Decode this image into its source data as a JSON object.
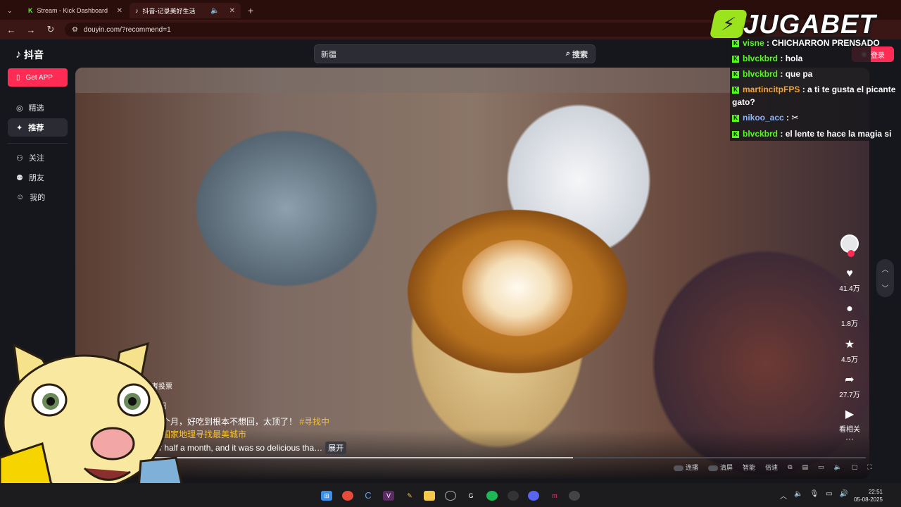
{
  "browser": {
    "tabs": [
      {
        "title": "Stream - Kick Dashboard",
        "active": false
      },
      {
        "title": "抖音-记录美好生活",
        "active": true
      }
    ],
    "new_tab": "+",
    "url": "douyin.com/?recommend=1"
  },
  "app": {
    "logo": "抖音",
    "get_app": "Get APP",
    "nav": [
      {
        "label": "精选",
        "icon": "compass-icon"
      },
      {
        "label": "推荐",
        "icon": "sparkle-icon",
        "active": true
      },
      {
        "label": "关注",
        "icon": "user-plus-icon"
      },
      {
        "label": "朋友",
        "icon": "users-icon"
      },
      {
        "label": "我的",
        "icon": "person-icon"
      }
    ],
    "search": {
      "value": "新疆",
      "button": "搜索"
    },
    "login": "登录"
  },
  "video": {
    "author": "作者投票",
    "date": "17日",
    "desc_line1": "了半个月，好吃到根本不想回，太顶了！",
    "desc_tag1": "#寻找中",
    "desc_line2": "中国国家地理寻找最美城市",
    "desc_line3": "g for half a month, and it was so delicious tha…",
    "expand": "展开",
    "progress": 0.6,
    "actions": {
      "likes": "41.4万",
      "comments": "1.8万",
      "favorites": "4.5万",
      "shares": "27.7万",
      "related": "看相关",
      "more": "···"
    },
    "controls": [
      "连播",
      "清屏",
      "智能",
      "倍速"
    ]
  },
  "chat": [
    {
      "user": "visne",
      "msg": "CHICHARRON PRENSADO",
      "color": "green"
    },
    {
      "user": "blvckbrd",
      "msg": "hola",
      "color": "green"
    },
    {
      "user": "blvckbrd",
      "msg": "que pa",
      "color": "green"
    },
    {
      "user": "martincitpFPS",
      "msg": "a ti te gusta el picante",
      "msg2": "gato?",
      "color": "orange"
    },
    {
      "user": "nikoo_acc",
      "msg": "",
      "color": "blue"
    },
    {
      "user": "blvckbrd",
      "msg": "el lente te hace la magia si",
      "color": "green"
    }
  ],
  "watermark": {
    "text": "JUGABET"
  },
  "taskbar": {
    "time": "22:51",
    "date": "05-08-2025"
  }
}
